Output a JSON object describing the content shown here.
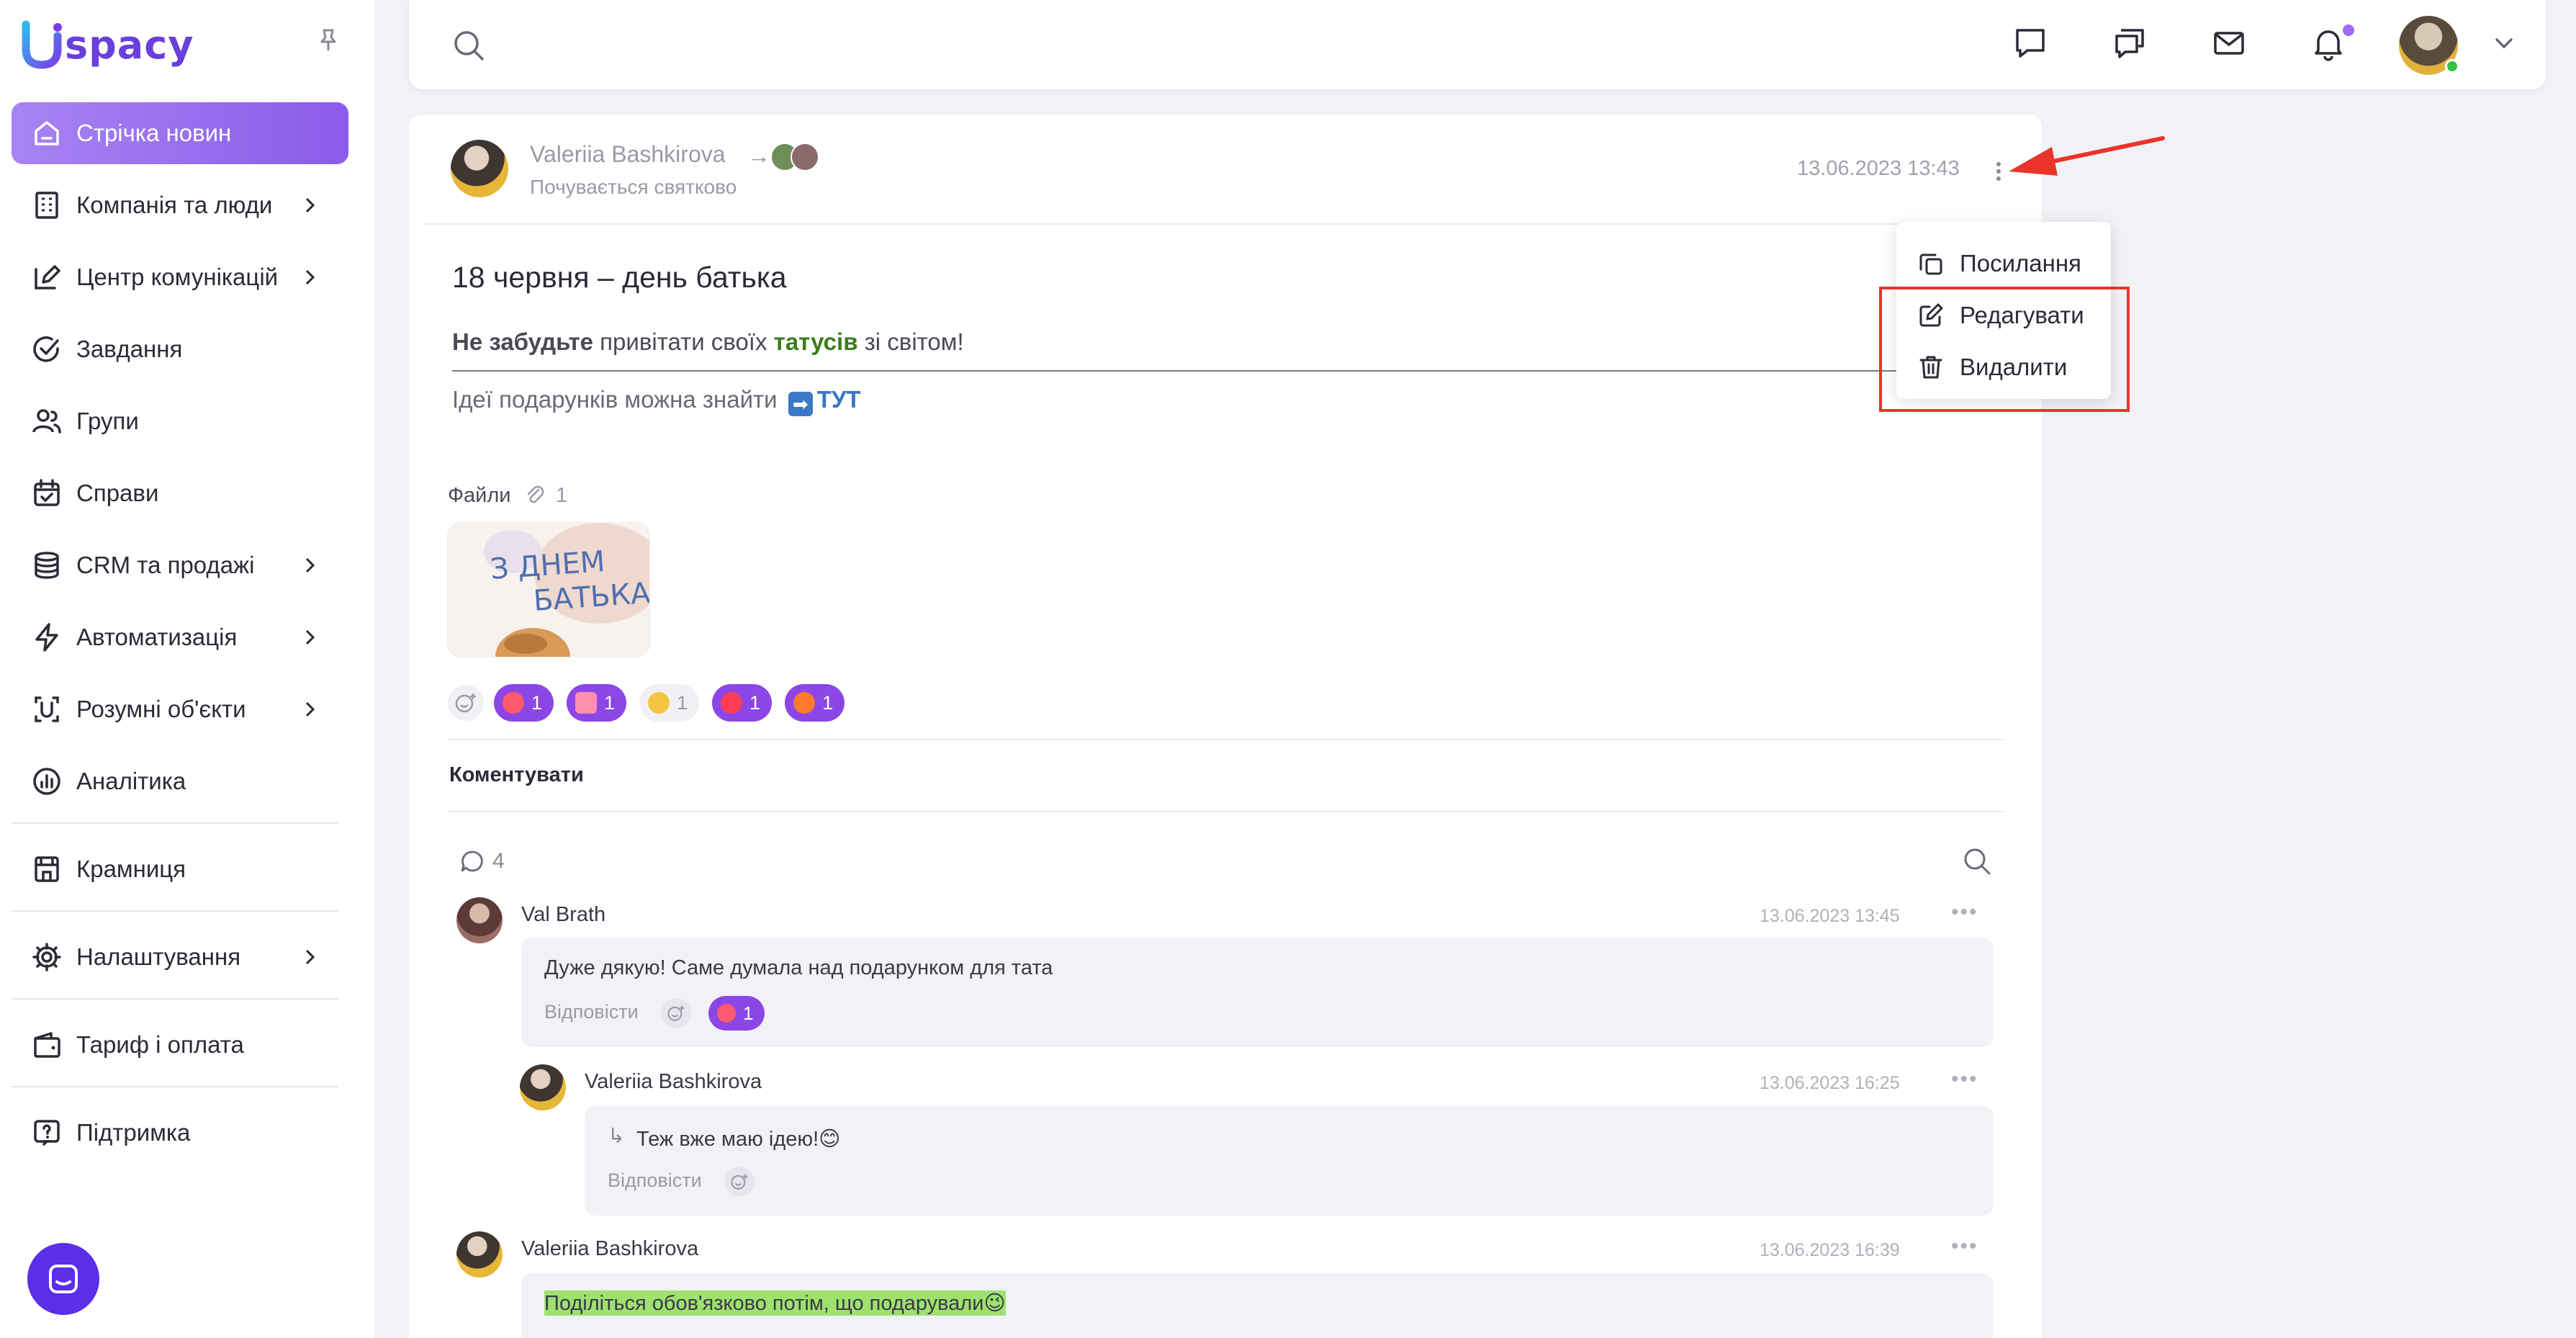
{
  "brand": {
    "name": "spacy",
    "logo_letter": "U",
    "accent": "#8a5be9",
    "logo_color": "#6a3fdc"
  },
  "sidebar": {
    "items": [
      {
        "label": "Стрічка новин",
        "icon": "home-icon",
        "active": true
      },
      {
        "label": "Компанія та люди",
        "icon": "building-icon",
        "chevron": true
      },
      {
        "label": "Центр комунікацій",
        "icon": "edit-note-icon",
        "chevron": true
      },
      {
        "label": "Завдання",
        "icon": "check-circle-icon"
      },
      {
        "label": "Групи",
        "icon": "users-icon"
      },
      {
        "label": "Справи",
        "icon": "calendar-check-icon"
      },
      {
        "label": "CRM та продажі",
        "icon": "database-icon",
        "chevron": true
      },
      {
        "label": "Автоматизація",
        "icon": "bolt-icon",
        "chevron": true
      },
      {
        "label": "Розумні об'єкти",
        "icon": "smart-object-icon",
        "chevron": true
      },
      {
        "label": "Аналітика",
        "icon": "chart-circle-icon"
      },
      {
        "label": "Крамниця",
        "icon": "store-icon"
      },
      {
        "label": "Налаштування",
        "icon": "gear-icon",
        "chevron": true
      },
      {
        "label": "Тариф і оплата",
        "icon": "wallet-icon"
      },
      {
        "label": "Підтримка",
        "icon": "help-icon"
      }
    ]
  },
  "post": {
    "author": "Valeriia Bashkirova",
    "feeling": "Почувається святково",
    "date": "13.06.2023 13:43",
    "title": "18 червня – день батька",
    "line1_bold": "Не забудьте",
    "line1_mid": " привітати своїх ",
    "line1_green": "татусів",
    "line1_end": " зі світом!",
    "line2_text": "Ідеї подарунків можна знайти ",
    "line2_arrow": "➡",
    "line2_link": "ТУТ",
    "files_label": "Файли",
    "files_count": "1",
    "thumb_text_1": "З ДНЕМ",
    "thumb_text_2": "БАТЬКА",
    "reactions": [
      {
        "count": "1",
        "color": "#8d46e6",
        "emoji_color": "#ff5a6e"
      },
      {
        "count": "1",
        "color": "#8d46e6",
        "emoji_color": "#ff8fb0"
      },
      {
        "count": "1",
        "color": "#f1f1f5",
        "emoji_color": "#f5c542"
      },
      {
        "count": "1",
        "color": "#8d46e6",
        "emoji_color": "#ff3d55"
      },
      {
        "count": "1",
        "color": "#8d46e6",
        "emoji_color": "#ff7a2e"
      }
    ],
    "comment_label": "Коментувати",
    "comment_count": "4"
  },
  "comments": [
    {
      "name": "Val Brath",
      "date": "13.06.2023 13:45",
      "text": "Дуже дякую! Саме думала над подарунком для тата",
      "reply": "Відповісти",
      "reaction_count": "1"
    },
    {
      "name": "Valeriia Bashkirova",
      "date": "13.06.2023 16:25",
      "text": "Теж вже маю ідею!😊",
      "reply": "Відповісти"
    },
    {
      "name": "Valeriia Bashkirova",
      "date": "13.06.2023 16:39",
      "text": "Поділіться обов'язково потім, що подарували😉"
    }
  ],
  "menu": {
    "items": [
      {
        "label": "Посилання",
        "icon": "copy-link-icon"
      },
      {
        "label": "Редагувати",
        "icon": "edit-icon"
      },
      {
        "label": "Видалити",
        "icon": "trash-icon"
      }
    ]
  },
  "annotation": {
    "highlight_color": "#e9342b"
  }
}
